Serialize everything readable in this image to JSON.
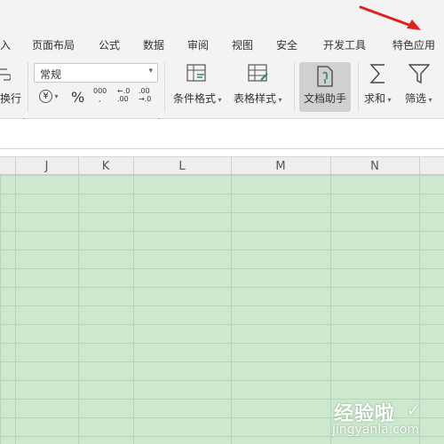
{
  "menu": {
    "tabs": [
      "入",
      "页面布局",
      "公式",
      "数据",
      "审阅",
      "视图",
      "安全",
      "开发工具",
      "特色应用"
    ]
  },
  "ribbon": {
    "wrap_label": "换行",
    "number_format": "常规",
    "currency_symbol": "¥",
    "percent_symbol": "%",
    "thousands_symbol": "000",
    "decrease_decimal": "←.0 .00",
    "increase_decimal": ".00 →.0",
    "conditional_format": "条件格式",
    "table_style": "表格样式",
    "doc_helper": "文档助手",
    "sum": "求和",
    "filter": "筛选"
  },
  "columns": [
    "J",
    "K",
    "L",
    "M",
    "N"
  ],
  "colors": {
    "grid_fill": "#cce8cf",
    "annotation_arrow": "#e0201a",
    "doc_helper_active": "#d0d0d0"
  },
  "watermark": {
    "brand": "经验啦",
    "url": "jingyanla.com"
  }
}
